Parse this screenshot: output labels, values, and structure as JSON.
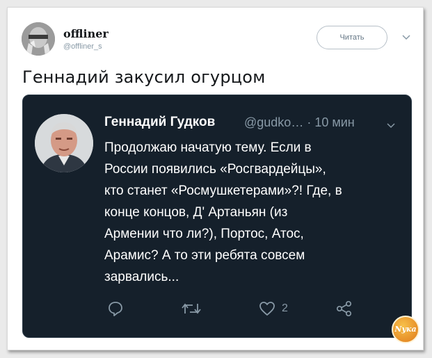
{
  "outer_tweet": {
    "author_name": "offliner",
    "author_handle": "@offliner_s",
    "follow_label": "Читать",
    "text": "Геннадий закусил огурцом"
  },
  "quoted_tweet": {
    "author_name": "Геннадий Гудков",
    "author_handle": "@gudko…",
    "time": "· 10 мин",
    "lines": [
      "Продолжаю начатую тему. Если в",
      "России появились «Росгвардейцы»,",
      "кто станет «Росмушкетерами»?! Где, в",
      "конце концов,  Д' Артаньян (из",
      "Армении что ли?), Портос, Атос,",
      "Арамис? А то эти ребята совсем",
      "зарвались..."
    ],
    "actions": {
      "reply_icon": "reply-icon",
      "retweet_icon": "retweet-icon",
      "like_icon": "heart-icon",
      "like_count": "2",
      "share_icon": "share-icon"
    }
  },
  "colors": {
    "embed_background": "#15202b",
    "secondary_text": "#8899a6"
  }
}
